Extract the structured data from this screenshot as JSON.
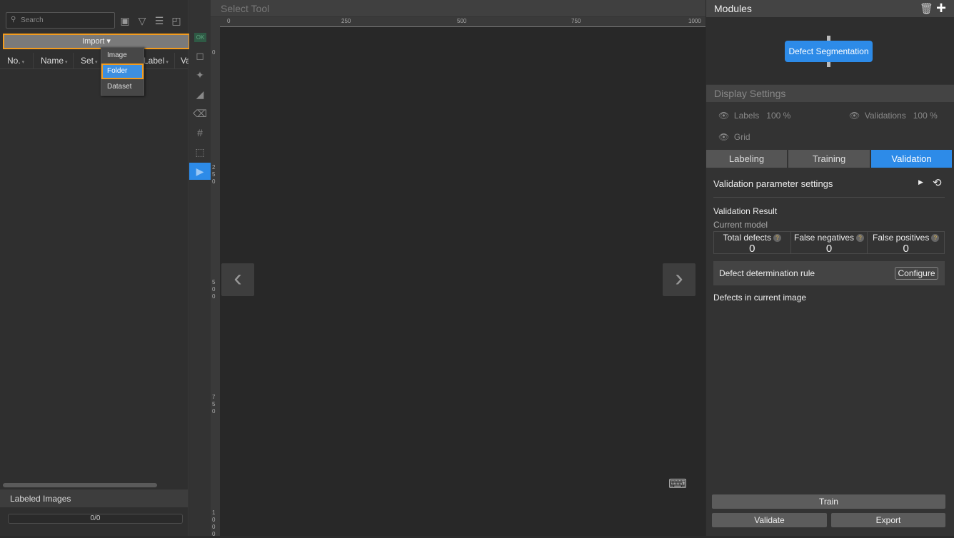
{
  "left": {
    "search_placeholder": "Search",
    "import_label": "Import",
    "import_menu": [
      "Image",
      "Folder",
      "Dataset"
    ],
    "columns": [
      "No.",
      "Name",
      "Set",
      "Label",
      "Va"
    ],
    "labeled_images": "Labeled Images",
    "progress": "0/0"
  },
  "center": {
    "title": "Select Tool",
    "ok": "OK",
    "h_ticks": [
      "0",
      "250",
      "500",
      "750",
      "1000"
    ],
    "v_ticks": [
      "0",
      "250",
      "500",
      "750",
      "1000"
    ]
  },
  "right": {
    "modules_title": "Modules",
    "module_node": "Defect Segmentation",
    "display_settings": "Display Settings",
    "labels": "Labels",
    "labels_pct": "100 %",
    "validations": "Validations",
    "validations_pct": "100 %",
    "grid": "Grid",
    "tabs": [
      "Labeling",
      "Training",
      "Validation"
    ],
    "active_tab": "Validation",
    "param_settings": "Validation parameter settings",
    "result_title": "Validation Result",
    "current_model": "Current model",
    "stats": [
      {
        "label": "Total defects",
        "value": "0"
      },
      {
        "label": "False negatives",
        "value": "0"
      },
      {
        "label": "False positives",
        "value": "0"
      }
    ],
    "rule": "Defect determination rule",
    "configure": "Configure",
    "defects_current": "Defects in current image",
    "train": "Train",
    "validate": "Validate",
    "export": "Export"
  },
  "colors": {
    "accent": "#2d8be8",
    "highlight": "#f39c1e"
  }
}
